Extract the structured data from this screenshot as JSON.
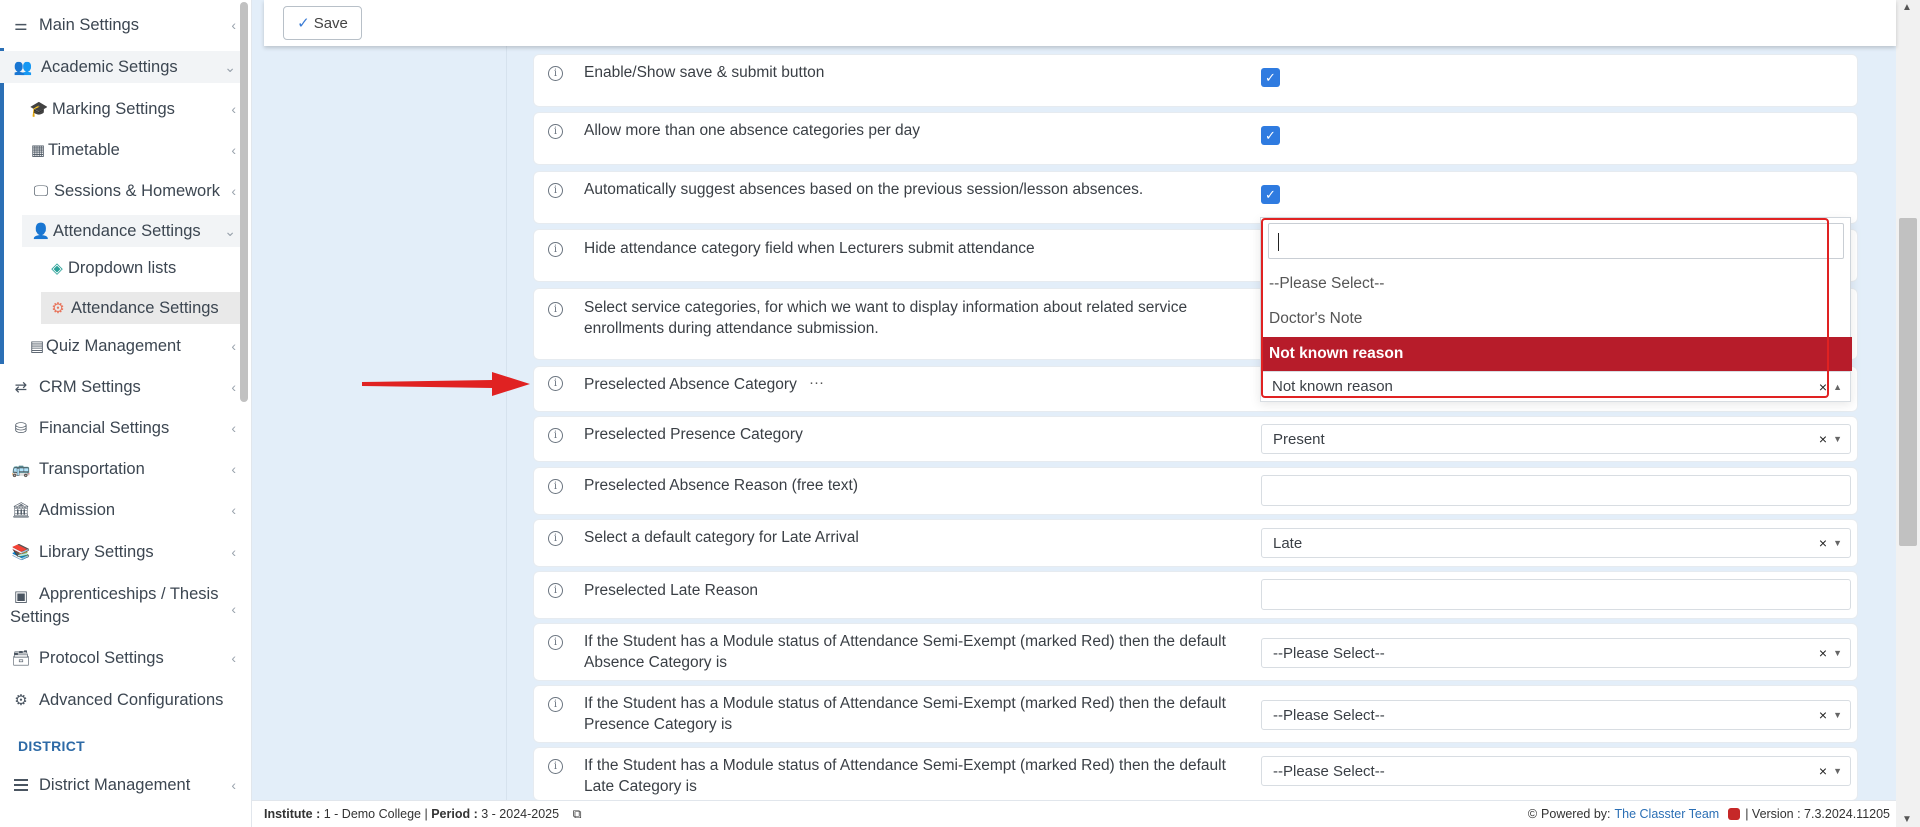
{
  "toolbar": {
    "save_label": "Save"
  },
  "sidebar": {
    "items": [
      {
        "label": "Main Settings",
        "icon": "sliders-icon"
      },
      {
        "label": "Academic Settings",
        "icon": "users-icon"
      },
      {
        "label": "Marking Settings",
        "icon": "graduation-cap-icon"
      },
      {
        "label": "Timetable",
        "icon": "calendar-icon"
      },
      {
        "label": "Sessions & Homework",
        "icon": "presentation-icon"
      },
      {
        "label": "Attendance Settings",
        "icon": "user-check-icon"
      },
      {
        "label": "Dropdown lists",
        "icon": "layers-icon"
      },
      {
        "label": "Attendance Settings",
        "icon": "cog-icon"
      },
      {
        "label": "Quiz Management",
        "icon": "list-icon"
      },
      {
        "label": "CRM Settings",
        "icon": "shuffle-icon"
      },
      {
        "label": "Financial Settings",
        "icon": "coins-icon"
      },
      {
        "label": "Transportation",
        "icon": "bus-icon"
      },
      {
        "label": "Admission",
        "icon": "institution-icon"
      },
      {
        "label": "Library Settings",
        "icon": "books-icon"
      },
      {
        "label_line1": "Apprenticeships / Thesis",
        "label_line2": "Settings",
        "icon": "box-icon"
      },
      {
        "label": "Protocol Settings",
        "icon": "archive-icon"
      },
      {
        "label": "Advanced Configurations",
        "icon": "cogs-icon"
      }
    ],
    "section_label": "DISTRICT",
    "district_item": {
      "label": "District Management",
      "icon": "bars-icon"
    }
  },
  "settings": {
    "rows": [
      {
        "label": "Enable/Show save & submit button",
        "control": "checkbox",
        "checked": true
      },
      {
        "label": "Allow more than one absence categories per day",
        "control": "checkbox",
        "checked": true
      },
      {
        "label": "Automatically suggest absences based on the previous session/lesson absences.",
        "control": "checkbox",
        "checked": true
      },
      {
        "label": "Hide attendance category field when Lecturers submit attendance",
        "control": "checkbox",
        "checked": false
      },
      {
        "label_line1": "Select service categories, for which we want to display information about related service",
        "label_line2": "enrollments during attendance submission.",
        "control": "select"
      },
      {
        "label": "Preselected Absence Category",
        "extra": "···",
        "control": "select",
        "value": "Not known reason"
      },
      {
        "label": "Preselected Presence Category",
        "control": "select",
        "value": "Present"
      },
      {
        "label": "Preselected Absence Reason (free text)",
        "control": "text",
        "value": ""
      },
      {
        "label": "Select a default category for Late Arrival",
        "control": "select",
        "value": "Late"
      },
      {
        "label": "Preselected Late Reason",
        "control": "text",
        "value": ""
      },
      {
        "label_line1": "If the Student has a Module status of Attendance Semi-Exempt (marked Red) then the default",
        "label_line2": "Absence Category is",
        "control": "select",
        "value": "--Please Select--"
      },
      {
        "label_line1": "If the Student has a Module status of Attendance Semi-Exempt (marked Red) then the default",
        "label_line2": "Presence Category is",
        "control": "select",
        "value": "--Please Select--"
      },
      {
        "label_line1": "If the Student has a Module status of Attendance Semi-Exempt (marked Red) then the default",
        "label_line2": "Late Category is",
        "control": "select",
        "value": "--Please Select--"
      }
    ]
  },
  "dropdown": {
    "search_value": "",
    "options": [
      "--Please Select--",
      "Doctor's Note",
      "Not known reason"
    ],
    "highlighted": "Not known reason",
    "current_value": "Not known reason"
  },
  "footer": {
    "institute_label": "Institute :",
    "institute_value": "1 - Demo College",
    "period_label": "Period :",
    "period_value": "3 - 2024-2025",
    "powered_by": "Powered by:",
    "team_link": "The Classter Team",
    "version": "Version : 7.3.2024.11205"
  },
  "colors": {
    "accent": "#2b6fb5",
    "highlight": "#b71c2a",
    "annotation_red": "#e02222"
  }
}
